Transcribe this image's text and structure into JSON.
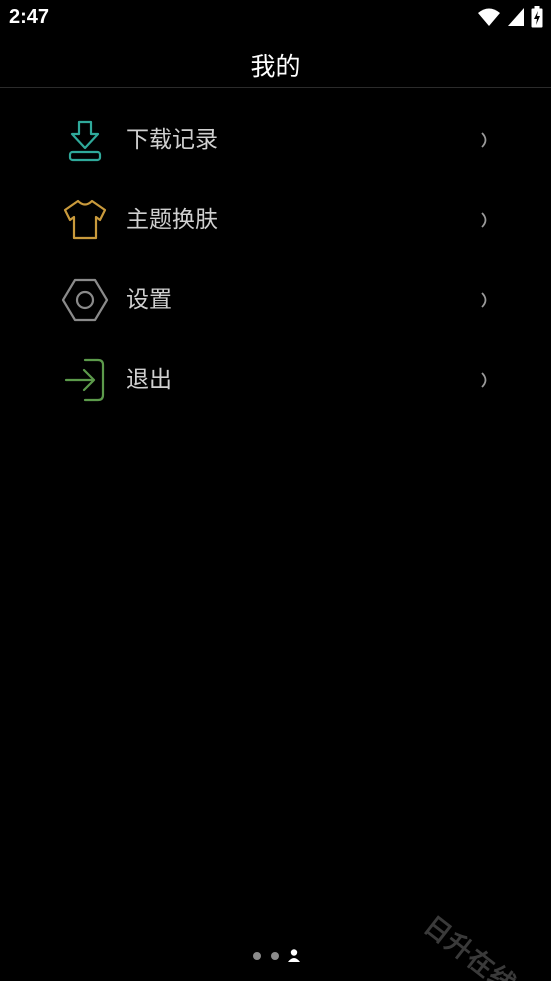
{
  "status_bar": {
    "time": "2:47",
    "icons": [
      "wifi-icon",
      "cell-signal-icon",
      "battery-charging-icon"
    ]
  },
  "header": {
    "title": "我的"
  },
  "menu": {
    "items": [
      {
        "label": "下载记录",
        "icon": "download-icon",
        "icon_color": "#2fa99a"
      },
      {
        "label": "主题换肤",
        "icon": "shirt-icon",
        "icon_color": "#c99a3c"
      },
      {
        "label": "设置",
        "icon": "hexagon-settings-icon",
        "icon_color": "#8a8a8a"
      },
      {
        "label": "退出",
        "icon": "logout-icon",
        "icon_color": "#5c9a4b"
      }
    ]
  },
  "footer": {
    "page_indicator": {
      "count": 3,
      "active_index": 2,
      "active_icon": "person-icon"
    },
    "watermark": "日升在线"
  }
}
